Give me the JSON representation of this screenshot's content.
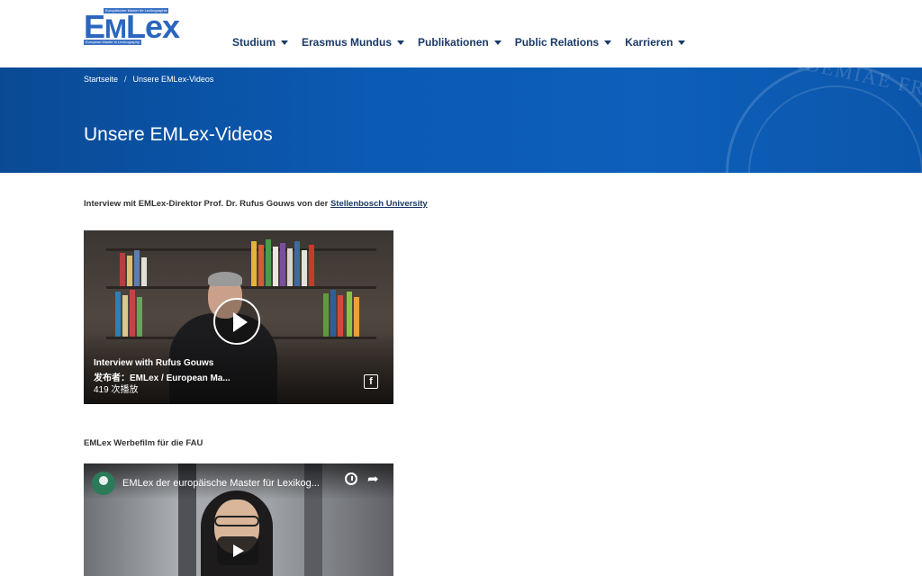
{
  "logo": {
    "letters_e": "E",
    "letters_m": "M",
    "letters_lex": "Lex",
    "tag_top": "Europäischer Master für Lexikographie",
    "tag_bottom": "European Master in Lexicography"
  },
  "nav": {
    "items": [
      {
        "label": "Studium"
      },
      {
        "label": "Erasmus Mundus"
      },
      {
        "label": "Publikationen"
      },
      {
        "label": "Public Relations"
      },
      {
        "label": "Karrieren"
      }
    ]
  },
  "banner": {
    "breadcrumb_home": "Startseite",
    "breadcrumb_sep": "/",
    "breadcrumb_current": "Unsere EMLex-Videos",
    "title": "Unsere EMLex-Videos",
    "seal_text": "ACADEMIAE FRIDERICO ALE"
  },
  "content": {
    "caption1_text": "Interview mit EMLex-Direktor Prof. Dr. Rufus Gouws von der ",
    "caption1_link": "Stellenbosch University",
    "video1": {
      "title": "Interview with Rufus Gouws",
      "publisher": "发布者：EMLex / European Ma...",
      "views": "419 次播放",
      "fb_icon_label": "f"
    },
    "caption2_text": "EMLex Werbefilm für die FAU",
    "video2": {
      "title": "EMLex der europäische Master für Lexikog...",
      "share_glyph": "➦"
    }
  },
  "colors": {
    "nav_text": "#1a3a66",
    "banner_blue": "#0b5ab3",
    "link": "#1a3a66"
  }
}
